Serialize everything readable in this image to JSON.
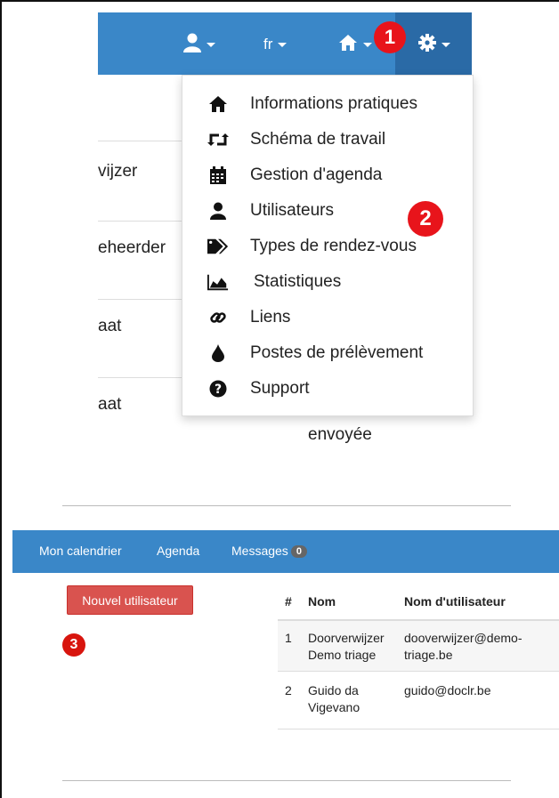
{
  "top_nav": {
    "user_menu": "user-icon",
    "language": "fr",
    "home_menu": "home-icon",
    "settings_menu": "gear-icon"
  },
  "callouts": {
    "one": "1",
    "two": "2",
    "three": "3"
  },
  "background_table": {
    "rows": [
      "vijzer",
      "eheerder",
      "aat",
      "aat"
    ],
    "status_text": "envoyée"
  },
  "settings_dropdown": {
    "items": [
      {
        "icon": "home-icon",
        "label": "Informations pratiques"
      },
      {
        "icon": "repeat-icon",
        "label": "Schéma de travail"
      },
      {
        "icon": "calendar-icon",
        "label": "Gestion d'agenda"
      },
      {
        "icon": "user-icon",
        "label": "Utilisateurs"
      },
      {
        "icon": "tags-icon",
        "label": "Types de rendez-vous"
      },
      {
        "icon": "area-chart-icon",
        "label": "Statistiques"
      },
      {
        "icon": "link-icon",
        "label": "Liens"
      },
      {
        "icon": "tint-icon",
        "label": "Postes de prélèvement"
      },
      {
        "icon": "question-circle-icon",
        "label": "Support"
      }
    ]
  },
  "app_nav": {
    "my_calendar": "Mon calendrier",
    "agenda": "Agenda",
    "messages": "Messages",
    "messages_count": "0"
  },
  "new_user_button": "Nouvel utilisateur",
  "users_table": {
    "headers": [
      "#",
      "Nom",
      "Nom d'utilisateur"
    ],
    "rows": [
      {
        "num": "1",
        "name_line1": "Doorverwijzer",
        "name_line2": "Demo triage",
        "username_line1": "dooverwijzer@demo-",
        "username_line2": "triage.be"
      },
      {
        "num": "2",
        "name_line1": "Guido da",
        "name_line2": "Vigevano",
        "username_line1": "guido@doclr.be",
        "username_line2": ""
      }
    ]
  },
  "colors": {
    "nav_blue": "#3a87c8",
    "nav_active": "#2a6aa6",
    "callout_red": "#e8141b",
    "button_red": "#d9534f"
  }
}
